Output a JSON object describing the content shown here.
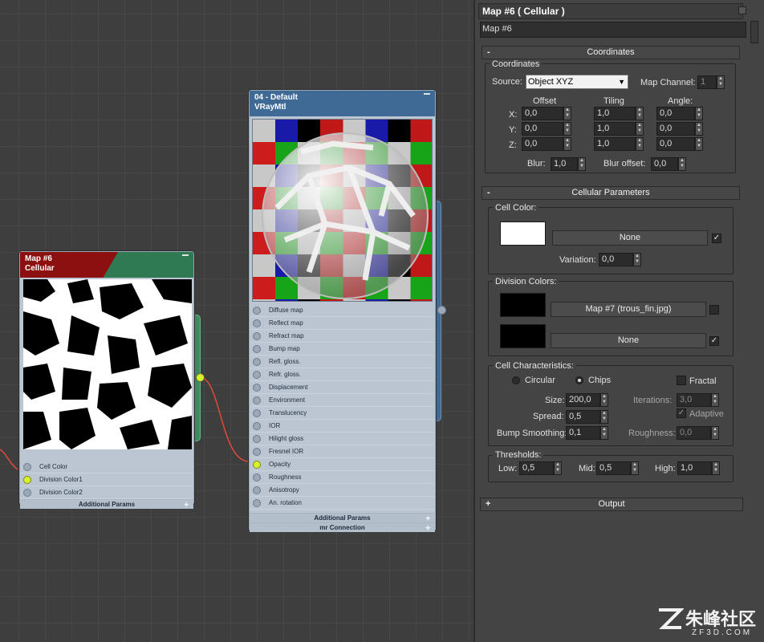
{
  "colors": {
    "node_header_red": "#8c1010",
    "node_header_green": "#2f7a52",
    "node_header_blue": "#3f6a96",
    "socket_active": "#d9f22e",
    "wire": "#e04a3a",
    "panel_bg": "#444444"
  },
  "cellular_node": {
    "title": "Map #6",
    "subtitle": "Cellular",
    "slots": [
      {
        "label": "Cell Color",
        "active": false
      },
      {
        "label": "Division Color1",
        "active": true
      },
      {
        "label": "Division Color2",
        "active": false
      }
    ],
    "footer": "Additional Params",
    "footer_icon": "plus-icon"
  },
  "vray_node": {
    "title": "04 - Default",
    "subtitle": "VRayMtl",
    "slots": [
      {
        "label": "Diffuse map",
        "active": false
      },
      {
        "label": "Reflect map",
        "active": false
      },
      {
        "label": "Refract map",
        "active": false
      },
      {
        "label": "Bump map",
        "active": false
      },
      {
        "label": "Refl. gloss.",
        "active": false
      },
      {
        "label": "Refr. gloss.",
        "active": false
      },
      {
        "label": "Displacement",
        "active": false
      },
      {
        "label": "Environment",
        "active": false
      },
      {
        "label": "Translucency",
        "active": false
      },
      {
        "label": "IOR",
        "active": false
      },
      {
        "label": "Hilight gloss",
        "active": false
      },
      {
        "label": "Fresnel IOR",
        "active": false
      },
      {
        "label": "Opacity",
        "active": true
      },
      {
        "label": "Roughness",
        "active": false
      },
      {
        "label": "Anisotropy",
        "active": false
      },
      {
        "label": "An. rotation",
        "active": false
      }
    ],
    "footers": [
      "Additional Params",
      "mr Connection"
    ],
    "footer_icon": "plus-icon"
  },
  "panel": {
    "title": "Map #6  ( Cellular )",
    "name_value": "Map #6",
    "coordinates": {
      "rollout": "Coordinates",
      "sign": "-",
      "group": "Coordinates",
      "source_label": "Source:",
      "source_value": "Object XYZ",
      "map_channel_label": "Map Channel:",
      "map_channel_value": "1",
      "col_offset": "Offset",
      "col_tiling": "Tiling",
      "col_angle": "Angle:",
      "rows": [
        {
          "axis": "X:",
          "offset": "0,0",
          "tiling": "1,0",
          "angle": "0,0"
        },
        {
          "axis": "Y:",
          "offset": "0,0",
          "tiling": "1,0",
          "angle": "0,0"
        },
        {
          "axis": "Z:",
          "offset": "0,0",
          "tiling": "1,0",
          "angle": "0,0"
        }
      ],
      "blur_label": "Blur:",
      "blur_value": "1,0",
      "blur_offset_label": "Blur offset:",
      "blur_offset_value": "0,0"
    },
    "cellular": {
      "rollout": "Cellular Parameters",
      "sign": "-",
      "cell_color_label": "Cell Color:",
      "cell_color_swatch": "#ffffff",
      "cell_map": "None",
      "cell_map_enabled": true,
      "variation_label": "Variation:",
      "variation_value": "0,0",
      "division_label": "Division Colors:",
      "division1_swatch": "#000000",
      "division1_map": "Map #7 (trous_fin.jpg)",
      "division1_enabled": false,
      "division2_swatch": "#000000",
      "division2_map": "None",
      "division2_enabled": true,
      "characteristics_label": "Cell Characteristics:",
      "circular_label": "Circular",
      "chips_label": "Chips",
      "selected_type": "Chips",
      "fractal_label": "Fractal",
      "fractal_checked": false,
      "size_label": "Size:",
      "size_value": "200,0",
      "iterations_label": "Iterations:",
      "iterations_value": "3,0",
      "spread_label": "Spread:",
      "spread_value": "0,5",
      "adaptive_label": "Adaptive",
      "adaptive_checked": true,
      "bump_label": "Bump Smoothing:",
      "bump_value": "0,1",
      "roughness_label": "Roughness:",
      "roughness_value": "0,0",
      "thresholds_label": "Thresholds:",
      "low_label": "Low:",
      "low_value": "0,5",
      "mid_label": "Mid:",
      "mid_value": "0,5",
      "high_label": "High:",
      "high_value": "1,0"
    },
    "output": {
      "rollout": "Output",
      "sign": "+"
    }
  },
  "watermark": {
    "brand": "朱峰社区",
    "domain": "ZF3D.COM"
  }
}
